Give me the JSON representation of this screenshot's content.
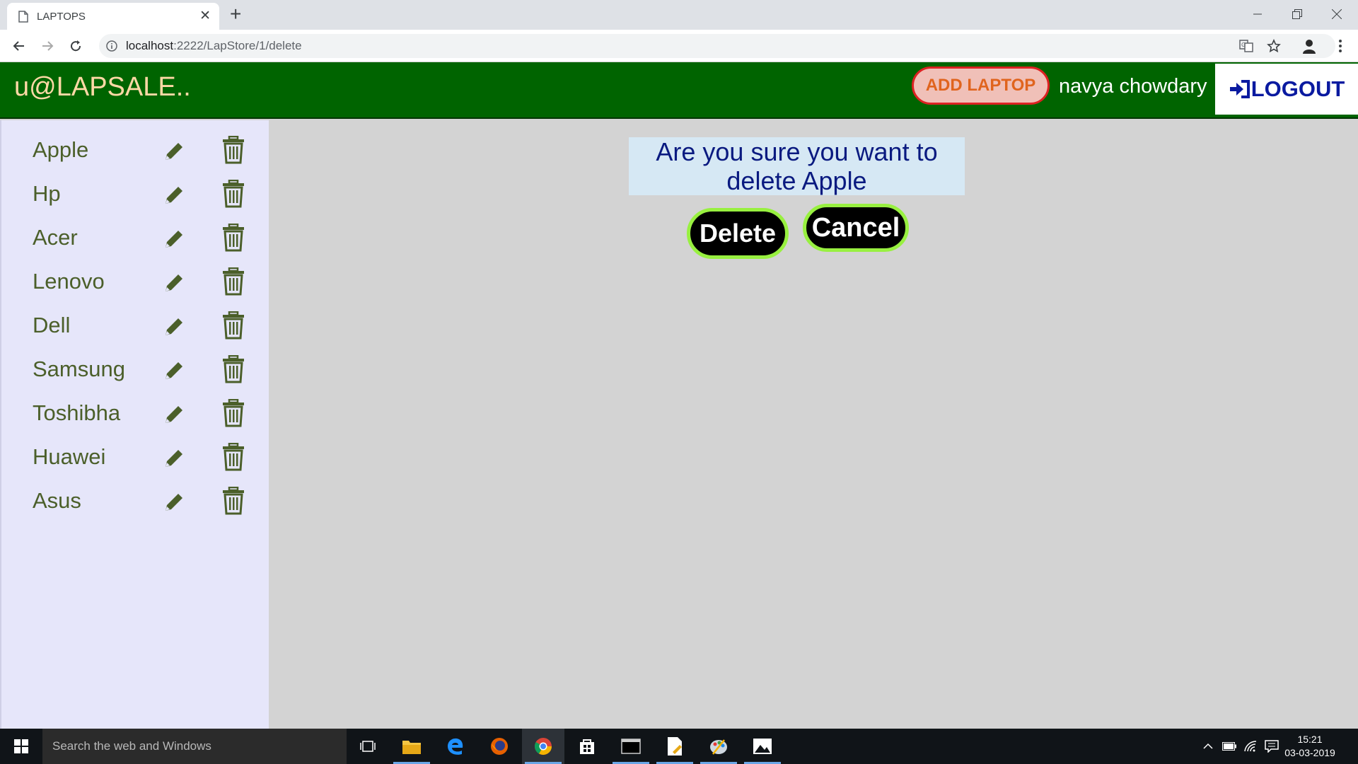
{
  "browser": {
    "tab_title": "LAPTOPS",
    "url_host": "localhost",
    "url_path": ":2222/LapStore/1/delete"
  },
  "header": {
    "brand": "u@LAPSALE..",
    "add_button": "ADD LAPTOP",
    "username": "navya chowdary",
    "logout": "LOGOUT"
  },
  "sidebar": {
    "items": [
      {
        "label": "Apple"
      },
      {
        "label": "Hp"
      },
      {
        "label": "Acer"
      },
      {
        "label": "Lenovo"
      },
      {
        "label": "Dell"
      },
      {
        "label": "Samsung"
      },
      {
        "label": "Toshibha"
      },
      {
        "label": "Huawei"
      },
      {
        "label": "Asus"
      }
    ]
  },
  "dialog": {
    "line1": "Are you sure you want to",
    "line2": "delete Apple",
    "delete_label": "Delete",
    "cancel_label": "Cancel"
  },
  "taskbar": {
    "search_placeholder": "Search the web and Windows",
    "time": "15:21",
    "date": "03-03-2019"
  },
  "colors": {
    "header_bg": "#006400",
    "sidebar_bg": "#e6e6fa",
    "main_bg": "#d3d3d3",
    "sidebar_text": "#4b5f2a",
    "button_border": "#98f040"
  }
}
